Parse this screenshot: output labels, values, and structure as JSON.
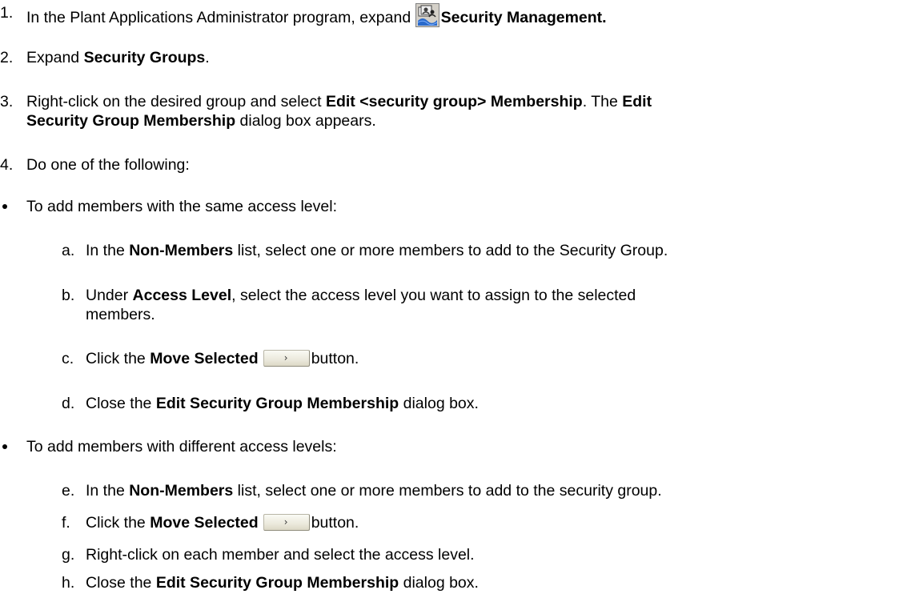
{
  "steps": [
    {
      "num": "1.",
      "pre": "In the Plant Applications Administrator program, expand ",
      "icon": "security-management-icon",
      "bold": "Security Management."
    },
    {
      "num": "2.",
      "pre": "Expand ",
      "bold": "Security Groups",
      "post": "."
    },
    {
      "num": "3.",
      "pre": "Right-click on the desired group and select ",
      "bold1": "Edit <security group> Membership",
      "mid": ". The ",
      "bold2": "Edit",
      "bold3": "Security Group Membership",
      "post": " dialog box appears."
    },
    {
      "num": "4.",
      "text": "Do one of the following:"
    }
  ],
  "bullets": [
    {
      "text": "To add members with the same access level:",
      "items": [
        {
          "letter": "a.",
          "pre": "In the ",
          "bold": "Non-Members",
          "post": " list, select one or more members to add to the Security Group."
        },
        {
          "letter": "b.",
          "pre": "Under ",
          "bold": "Access Level",
          "post": ", select the access level you want to assign to the selected",
          "cont": "members."
        },
        {
          "letter": "c.",
          "pre": "Click the ",
          "bold": "Move Selected",
          "button_glyph": "›",
          "post": "button."
        },
        {
          "letter": "d.",
          "pre": "Close the ",
          "bold": "Edit Security Group Membership",
          "post": " dialog box."
        }
      ]
    },
    {
      "text": "To add members with different access levels:",
      "items": [
        {
          "letter": "e.",
          "pre": "In the ",
          "bold": "Non-Members",
          "post": " list, select one or more members to add to the security group."
        },
        {
          "letter": "f.",
          "pre": "Click the ",
          "bold": "Move Selected",
          "button_glyph": "›",
          "post": "button."
        },
        {
          "letter": "g.",
          "text": "Right-click on each member and select the access level."
        },
        {
          "letter": "h.",
          "pre": "Close the ",
          "bold": "Edit Security Group Membership",
          "post": " dialog box."
        }
      ]
    }
  ]
}
